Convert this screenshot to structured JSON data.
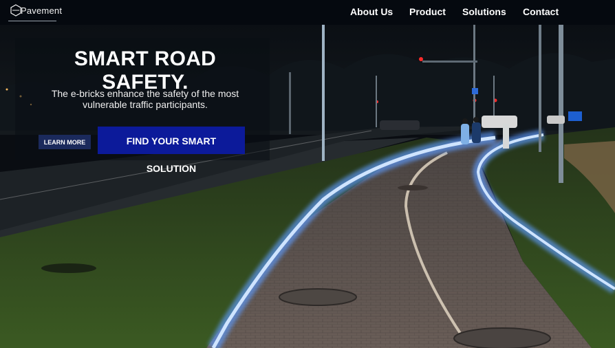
{
  "brand": {
    "logo_text": "Pavement"
  },
  "nav": {
    "items": [
      {
        "label": "About Us"
      },
      {
        "label": "Product"
      },
      {
        "label": "Solutions"
      },
      {
        "label": "Contact"
      }
    ]
  },
  "hero": {
    "headline": "SMART ROAD SAFETY.",
    "subline": "The e-bricks enhance the safety of the most vulnerable traffic participants.",
    "learn_more_label": "LEARN MORE",
    "find_solution_label": "FIND YOUR SMART SOLUTION"
  },
  "colors": {
    "navbar_bg": "#05090f",
    "primary_button": "#0c1a9a",
    "secondary_button": "#1b2a5c",
    "glow_line": "#7fb8ff"
  }
}
